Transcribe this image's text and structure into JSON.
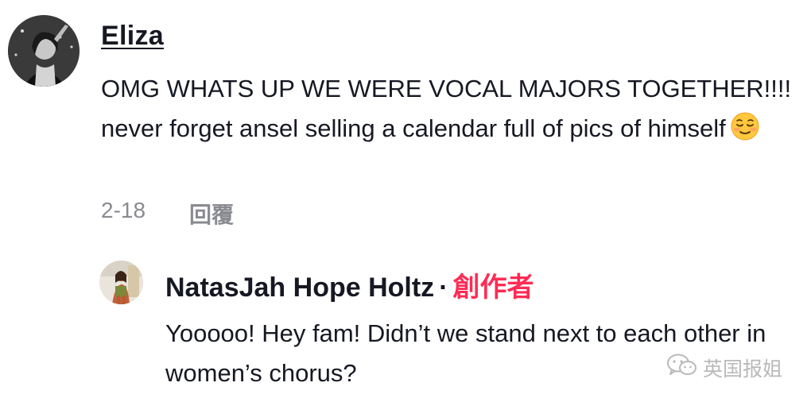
{
  "comment": {
    "username": "Eliza",
    "text": "OMG WHATS UP WE WERE VOCAL MAJORS TOGETHER!!!! never forget ansel selling a calendar full of pics of himself",
    "emoji": "relieved-face-emoji",
    "date": "2-18",
    "reply_label": "回覆"
  },
  "reply": {
    "username": "NatasJah Hope Holtz",
    "separator": "·",
    "creator_badge": "創作者",
    "text": "Yooooo! Hey fam! Didn’t we stand next to each other in women’s chorus?"
  },
  "watermark": {
    "text": "英国报姐",
    "icon": "wechat-icon"
  },
  "colors": {
    "text": "#161823",
    "muted": "#8a8b91",
    "creator": "#fe2c55",
    "watermark": "#b9b9b9"
  }
}
